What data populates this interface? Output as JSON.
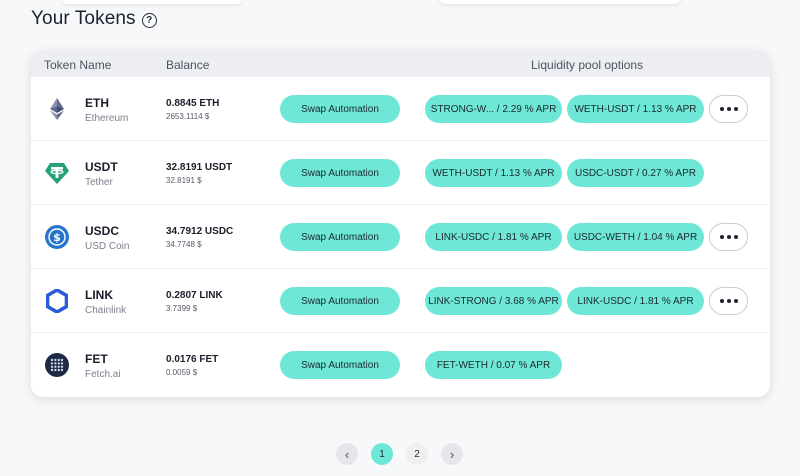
{
  "page": {
    "title": "Your Tokens"
  },
  "table": {
    "headers": {
      "name": "Token Name",
      "balance": "Balance",
      "liquidity": "Liquidity pool options"
    },
    "rows": [
      {
        "symbol": "ETH",
        "name": "Ethereum",
        "balance": "0.8845 ETH",
        "usd": "2653.1114 $",
        "icon": "ethereum-icon",
        "swap": "Swap Automation",
        "pools": [
          "STRONG-W...  / 2.29 % APR",
          "WETH-USDT / 1.13 % APR"
        ],
        "more": true
      },
      {
        "symbol": "USDT",
        "name": "Tether",
        "balance": "32.8191 USDT",
        "usd": "32.8191 $",
        "icon": "tether-icon",
        "swap": "Swap Automation",
        "pools": [
          "WETH-USDT / 1.13 % APR",
          "USDC-USDT / 0.27 % APR"
        ],
        "more": false
      },
      {
        "symbol": "USDC",
        "name": "USD Coin",
        "balance": "34.7912 USDC",
        "usd": "34.7748 $",
        "icon": "usd-coin-icon",
        "swap": "Swap Automation",
        "pools": [
          "LINK-USDC / 1.81 % APR",
          "USDC-WETH / 1.04 % APR"
        ],
        "more": true
      },
      {
        "symbol": "LINK",
        "name": "Chainlink",
        "balance": "0.2807 LINK",
        "usd": "3.7399 $",
        "icon": "chainlink-icon",
        "swap": "Swap Automation",
        "pools": [
          "LINK-STRONG / 3.68 % APR",
          "LINK-USDC / 1.81 % APR"
        ],
        "more": true
      },
      {
        "symbol": "FET",
        "name": "Fetch.ai",
        "balance": "0.0176 FET",
        "usd": "0.0059 $",
        "icon": "fetch-ai-icon",
        "swap": "Swap Automation",
        "pools": [
          "FET-WETH / 0.07 % APR"
        ],
        "more": false
      }
    ]
  },
  "pagination": {
    "prev": "‹",
    "pages": [
      "1",
      "2"
    ],
    "active": "1",
    "next": "›"
  },
  "colors": {
    "accent": "#6ee7d7",
    "eth": "#627eea",
    "usdt": "#26a17b",
    "usdc": "#2775ca",
    "link": "#2a5ada",
    "fet": "#1d2a44"
  }
}
